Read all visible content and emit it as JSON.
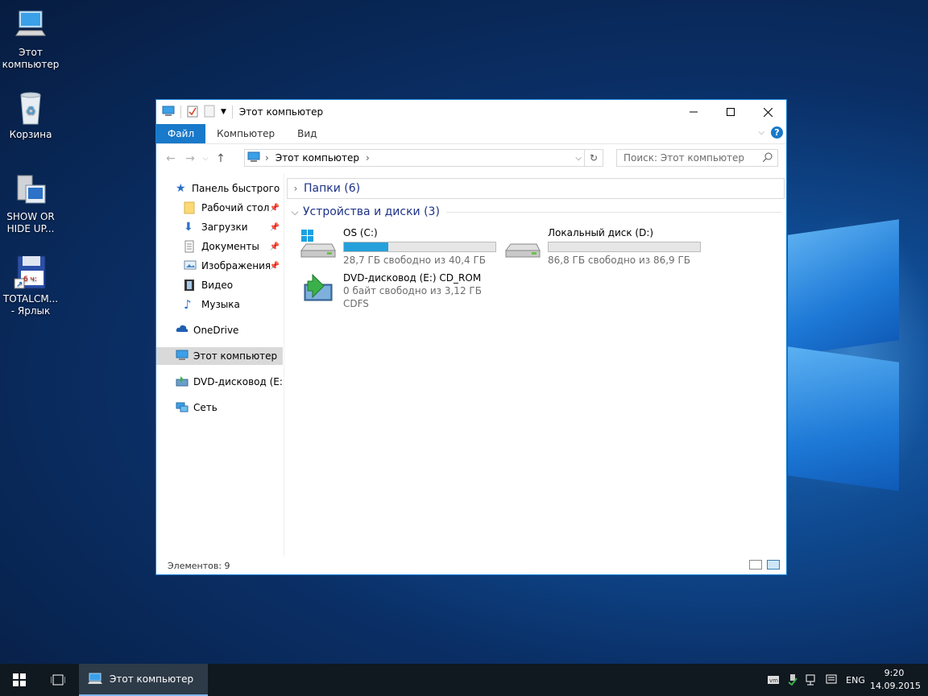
{
  "desktop": {
    "icons": [
      {
        "label": "Этот компьютер",
        "icon": "this-pc-icon"
      },
      {
        "label": "Корзина",
        "icon": "recycle-bin-icon"
      },
      {
        "label": "SHOW OR HIDE UP...",
        "icon": "shortcut-icon"
      },
      {
        "label": "TOTALCM... - Ярлык",
        "icon": "totalcmd-shortcut-icon"
      }
    ]
  },
  "window": {
    "title": "Этот компьютер",
    "ribbon_tabs": [
      "Файл",
      "Компьютер",
      "Вид"
    ],
    "address": "Этот компьютер",
    "search_placeholder": "Поиск: Этот компьютер",
    "nav": {
      "quick_access": "Панель быстрого доступа",
      "items": [
        {
          "label": "Рабочий стол",
          "pinned": true
        },
        {
          "label": "Загрузки",
          "pinned": true
        },
        {
          "label": "Документы",
          "pinned": true
        },
        {
          "label": "Изображения",
          "pinned": true
        },
        {
          "label": "Видео",
          "pinned": false
        },
        {
          "label": "Музыка",
          "pinned": false
        }
      ],
      "onedrive": "OneDrive",
      "this_pc": "Этот компьютер",
      "dvd": "DVD-дисковод (E:) CD_ROM",
      "network": "Сеть"
    },
    "groups": {
      "folders": "Папки (6)",
      "devices": "Устройства и диски (3)"
    },
    "drives": [
      {
        "name": "OS (C:)",
        "free": "28,7 ГБ свободно из 40,4 ГБ",
        "used_fraction": 0.29
      },
      {
        "name": "Локальный диск (D:)",
        "free": "86,8 ГБ свободно из 86,9 ГБ",
        "used_fraction": 0.0
      },
      {
        "name": "DVD-дисковод (E:) CD_ROM",
        "free": "0 байт свободно из 3,12 ГБ",
        "fs": "CDFS"
      }
    ],
    "status": "Элементов: 9"
  },
  "taskbar": {
    "app_label": "Этот компьютер",
    "lang": "ENG",
    "time": "9:20",
    "date": "14.09.2015"
  },
  "colors": {
    "accent": "#1979ca",
    "bar_fill": "#26a0da",
    "group_text": "#1e3287"
  }
}
